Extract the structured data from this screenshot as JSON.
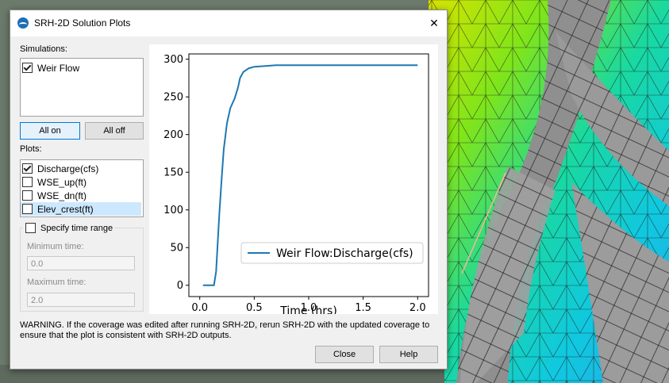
{
  "window": {
    "title": "SRH-2D Solution Plots",
    "close_glyph": "✕"
  },
  "simulations": {
    "label": "Simulations:",
    "items": [
      {
        "label": "Weir Flow",
        "checked": true
      }
    ],
    "all_on": "All on",
    "all_off": "All off"
  },
  "plots": {
    "label": "Plots:",
    "items": [
      {
        "label": "Discharge(cfs)",
        "checked": true
      },
      {
        "label": "WSE_up(ft)",
        "checked": false
      },
      {
        "label": "WSE_dn(ft)",
        "checked": false
      },
      {
        "label": "Elev_crest(ft)",
        "checked": false
      }
    ]
  },
  "time_range": {
    "label": "Specify time range",
    "checked": false,
    "min_label": "Minimum time:",
    "min_value": "0.0",
    "max_label": "Maximum time:",
    "max_value": "2.0"
  },
  "chart_data": {
    "type": "line",
    "title": "",
    "xlabel": "Time (hrs)",
    "ylabel": "",
    "xlim": [
      -0.1,
      2.1
    ],
    "ylim": [
      -15,
      307
    ],
    "xticks": [
      "0.0",
      "0.5",
      "1.0",
      "1.5",
      "2.0"
    ],
    "xtick_values": [
      0,
      0.5,
      1.0,
      1.5,
      2.0
    ],
    "yticks": [
      "0",
      "50",
      "100",
      "150",
      "200",
      "250",
      "300"
    ],
    "ytick_values": [
      0,
      50,
      100,
      150,
      200,
      250,
      300
    ],
    "legend_position": "lower-right",
    "series": [
      {
        "name": "Weir Flow:Discharge(cfs)",
        "color": "#1f77b4",
        "x": [
          0.03,
          0.13,
          0.15,
          0.18,
          0.2,
          0.22,
          0.25,
          0.28,
          0.32,
          0.35,
          0.37,
          0.4,
          0.45,
          0.5,
          0.6,
          0.7,
          0.8,
          1.0,
          1.5,
          2.0
        ],
        "y": [
          0,
          0,
          18,
          95,
          140,
          180,
          215,
          235,
          248,
          262,
          275,
          283,
          288,
          290,
          291,
          292,
          292,
          292,
          292,
          292
        ]
      }
    ]
  },
  "warning_text": "WARNING. If the coverage was edited after running SRH-2D, rerun SRH-2D with the updated coverage to ensure that the plot is consistent with SRH-2D outputs.",
  "buttons": {
    "close": "Close",
    "help": "Help"
  },
  "colors": {
    "accent": "#0078d7",
    "series": "#1f77b4"
  }
}
